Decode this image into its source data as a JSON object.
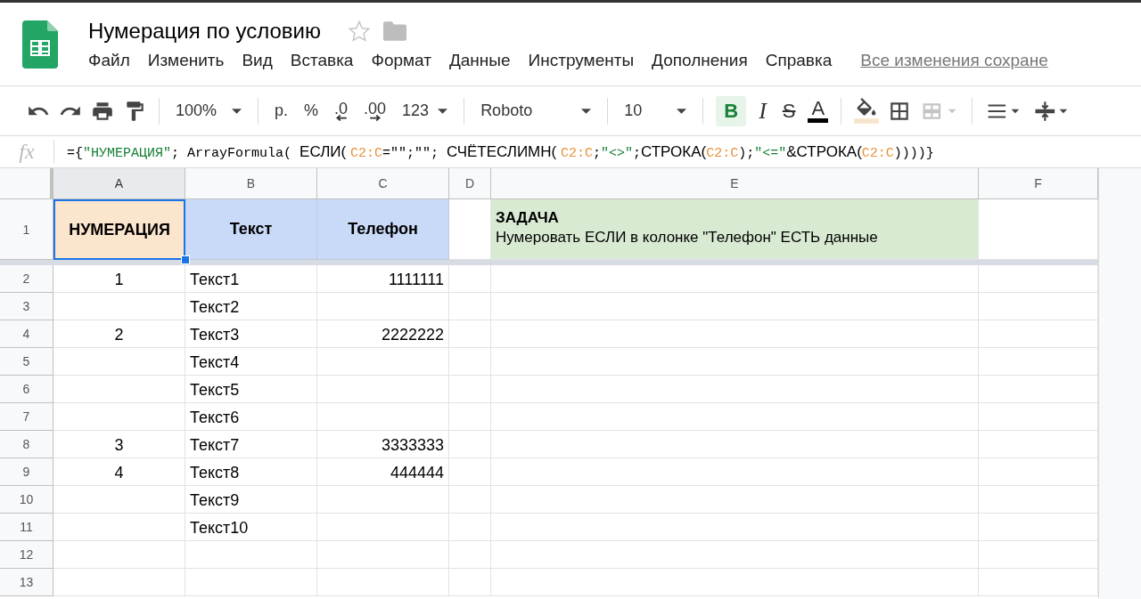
{
  "document": {
    "title": "Нумерация по условию",
    "starred": false
  },
  "menu": [
    "Файл",
    "Изменить",
    "Вид",
    "Вставка",
    "Формат",
    "Данные",
    "Инструменты",
    "Дополнения",
    "Справка"
  ],
  "save_status": "Все изменения сохране",
  "toolbar": {
    "zoom": "100%",
    "currency": "р.",
    "percent": "%",
    "decrease_decimals": ".0",
    "increase_decimals": ".00",
    "number_format": "123",
    "font": "Roboto",
    "font_size": "10",
    "bold_label": "B",
    "bold_active": true,
    "italic_label": "I",
    "strike_label": "S",
    "text_color_label": "A"
  },
  "formula_bar": {
    "label": "fx",
    "segments": [
      {
        "kind": "op",
        "text": "={"
      },
      {
        "kind": "string",
        "text": "\"НУМЕРАЦИЯ\""
      },
      {
        "kind": "op",
        "text": "; ArrayFormula( "
      },
      {
        "kind": "func",
        "text": "ЕСЛИ( "
      },
      {
        "kind": "range",
        "text": "C2:C"
      },
      {
        "kind": "op",
        "text": "=\"\";\"\"; "
      },
      {
        "kind": "func",
        "text": "СЧЁТЕСЛИМН( "
      },
      {
        "kind": "range",
        "text": "C2:C"
      },
      {
        "kind": "op",
        "text": ";"
      },
      {
        "kind": "string",
        "text": "\"<>\""
      },
      {
        "kind": "op",
        "text": ";"
      },
      {
        "kind": "func",
        "text": "СТРОКА("
      },
      {
        "kind": "range",
        "text": "C2:C"
      },
      {
        "kind": "op",
        "text": ");"
      },
      {
        "kind": "string",
        "text": "\"<=\""
      },
      {
        "kind": "func",
        "text": "&СТРОКА("
      },
      {
        "kind": "range",
        "text": "C2:C"
      },
      {
        "kind": "op",
        "text": "))))}"
      }
    ]
  },
  "columns": [
    {
      "label": "A",
      "selected": true
    },
    {
      "label": "B",
      "selected": false
    },
    {
      "label": "C",
      "selected": false
    },
    {
      "label": "D",
      "selected": false
    },
    {
      "label": "E",
      "selected": false
    },
    {
      "label": "F",
      "selected": false
    }
  ],
  "header_row": {
    "number": "1",
    "cells": [
      {
        "text": "НУМЕРАЦИЯ",
        "color": "#fce5cd",
        "selected": true
      },
      {
        "text": "Текст",
        "color": "#c9daf8",
        "selected": false
      },
      {
        "text": "Телефон",
        "color": "#c9daf8",
        "selected": false
      }
    ],
    "task": {
      "title": "ЗАДАЧА",
      "text": "Нумеровать ЕСЛИ в колонке \"Телефон\" ЕСТЬ данные",
      "color": "#d9ead3"
    }
  },
  "rows": [
    {
      "number": "2",
      "a": "1",
      "b": "Текст1",
      "c": "1111111"
    },
    {
      "number": "3",
      "b": "Текст2"
    },
    {
      "number": "4",
      "a": "2",
      "b": "Текст3",
      "c": "2222222"
    },
    {
      "number": "5",
      "b": "Текст4"
    },
    {
      "number": "6",
      "b": "Текст5"
    },
    {
      "number": "7",
      "b": "Текст6"
    },
    {
      "number": "8",
      "a": "3",
      "b": "Текст7",
      "c": "3333333"
    },
    {
      "number": "9",
      "a": "4",
      "b": "Текст8",
      "c": "444444"
    },
    {
      "number": "10",
      "b": "Текст9"
    },
    {
      "number": "11",
      "b": "Текст10"
    },
    {
      "number": "12"
    },
    {
      "number": "13"
    }
  ]
}
